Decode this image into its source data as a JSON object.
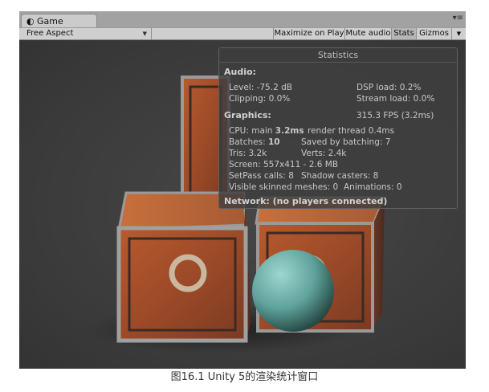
{
  "window": {
    "tab_icon": "unity-logo-icon",
    "tab_label": "Game",
    "menu_icon": "window-menu-icon"
  },
  "toolbar": {
    "aspect_value": "Free Aspect",
    "maximize_label": "Maximize on Play",
    "mute_label": "Mute audio",
    "stats_label": "Stats",
    "gizmos_label": "Gizmos"
  },
  "stats": {
    "title": "Statistics",
    "audio_header": "Audio:",
    "level": "Level: -75.2 dB",
    "dsp_load": "DSP load: 0.2%",
    "clipping": "Clipping: 0.0%",
    "stream_load": "Stream load: 0.0%",
    "graphics_header": "Graphics:",
    "fps": "315.3 FPS (3.2ms)",
    "cpu_prefix": "CPU: main ",
    "cpu_main": "3.2ms",
    "render_thread": "render thread 0.4ms",
    "batches_prefix": "Batches: ",
    "batches": "10",
    "saved_batching": "Saved by batching: 7",
    "tris": "Tris: 3.2k",
    "verts": "Verts: 2.4k",
    "screen": "Screen: 557x411 - 2.6 MB",
    "setpass": "SetPass calls: 8",
    "shadow_casters": "Shadow casters: 8",
    "skinned_meshes": "Visible skinned meshes: 0",
    "animations": "Animations: 0",
    "network": "Network: (no players connected)"
  },
  "caption": "图16.1  Unity 5的渲染统计窗口"
}
